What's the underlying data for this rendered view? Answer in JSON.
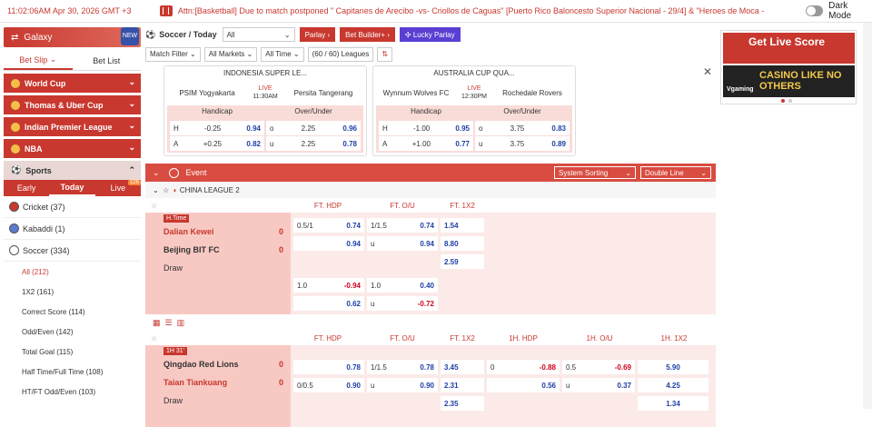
{
  "topbar": {
    "time": "11:02:06AM Apr 30, 2026 GMT +3",
    "ticker": "Attn:[Basketball] Due to match postponed \" Capitanes de Arecibo -vs- Criollos de Caguas\" [Puerto Rico Baloncesto Superior Nacional - 29/4] & \"Heroes de Moca -",
    "dark_mode": "Dark Mode"
  },
  "left": {
    "galaxy": "Galaxy",
    "new_badge": "NEW",
    "bet_slip": "Bet Slip",
    "bet_list": "Bet List",
    "cats": [
      "World Cup",
      "Thomas & Uber Cup",
      "Indian Premier League",
      "NBA"
    ],
    "sports_label": "Sports",
    "time_tabs": [
      "Early",
      "Today",
      "Live"
    ],
    "live_count": "126",
    "sports": [
      {
        "name": "Cricket",
        "count": "(37)"
      },
      {
        "name": "Kabaddi",
        "count": "(1)"
      },
      {
        "name": "Soccer",
        "count": "(334)"
      }
    ],
    "subs": [
      "All  (212)",
      "1X2  (161)",
      "Correct Score  (114)",
      "Odd/Even  (142)",
      "Total Goal  (115)",
      "Half Time/Full Time  (108)",
      "HT/FT Odd/Even  (103)"
    ]
  },
  "filters": {
    "title": "Soccer / Today",
    "sport_select": "All",
    "parlay": "Parlay",
    "bet_builder": "Bet Builder+",
    "lucky": "Lucky Parlay",
    "match_filter": "Match Filter",
    "all_markets": "All Markets",
    "all_time": "All Time",
    "leagues": "(60 / 60) Leagues"
  },
  "cards": [
    {
      "league": "INDONESIA SUPER LE...",
      "home": "PSIM Yogyakarta",
      "live": "LIVE",
      "time": "11:30AM",
      "away": "Persita Tangerang",
      "hdr1": "Handicap",
      "hdr2": "Over/Under",
      "rows": [
        {
          "a": "H",
          "b": "-0.25",
          "c": "0.94",
          "d": "o",
          "e": "2.25",
          "f": "0.96"
        },
        {
          "a": "A",
          "b": "+0.25",
          "c": "0.82",
          "d": "u",
          "e": "2.25",
          "f": "0.78"
        }
      ]
    },
    {
      "league": "AUSTRALIA CUP QUA...",
      "home": "Wynnum Wolves FC",
      "live": "LIVE",
      "time": "12:30PM",
      "away": "Rochedale Rovers",
      "hdr1": "Handicap",
      "hdr2": "Over/Under",
      "rows": [
        {
          "a": "H",
          "b": "-1.00",
          "c": "0.95",
          "d": "o",
          "e": "3.75",
          "f": "0.83"
        },
        {
          "a": "A",
          "b": "+1.00",
          "c": "0.77",
          "d": "u",
          "e": "3.75",
          "f": "0.89"
        }
      ]
    }
  ],
  "event": {
    "label": "Event",
    "sorting": "System Sorting",
    "double_line": "Double Line",
    "league": "CHINA LEAGUE 2"
  },
  "m1": {
    "badge": "H.Time",
    "cols": [
      "FT. HDP",
      "FT. O/U",
      "FT. 1X2"
    ],
    "home": "Dalian Kewei",
    "home_score": "0",
    "away": "Beijing BIT FC",
    "away_score": "0",
    "draw": "Draw",
    "r1": [
      "0.5/1",
      "0.74",
      "1/1.5",
      "0.74",
      "1.54"
    ],
    "r2": [
      "",
      "0.94",
      "u",
      "0.94",
      "8.80"
    ],
    "r3": [
      "2.59"
    ],
    "x1": [
      "1.0",
      "-0.94",
      "1.0",
      "0.40"
    ],
    "x2": [
      "",
      "0.62",
      "u",
      "-0.72"
    ]
  },
  "m2": {
    "badge": "1H  31'",
    "cols": [
      "FT. HDP",
      "FT. O/U",
      "FT. 1X2",
      "1H. HDP",
      "1H. O/U",
      "1H. 1X2"
    ],
    "home": "Qingdao Red Lions",
    "home_score": "0",
    "away": "Taian Tiankuang",
    "away_score": "0",
    "draw": "Draw",
    "r1": [
      "",
      "0.78",
      "1/1.5",
      "0.78",
      "3.45",
      "0",
      "-0.88",
      "0.5",
      "-0.69",
      "5.90"
    ],
    "r2": [
      "0/0.5",
      "0.90",
      "u",
      "0.90",
      "2.31",
      "",
      "0.56",
      "u",
      "0.37",
      "4.25"
    ],
    "r3": [
      "2.35",
      "1.34"
    ]
  },
  "ads": {
    "b1": "Get Live Score",
    "b2": "CASINO LIKE NO OTHERS",
    "b2brand": "Vgaming"
  }
}
